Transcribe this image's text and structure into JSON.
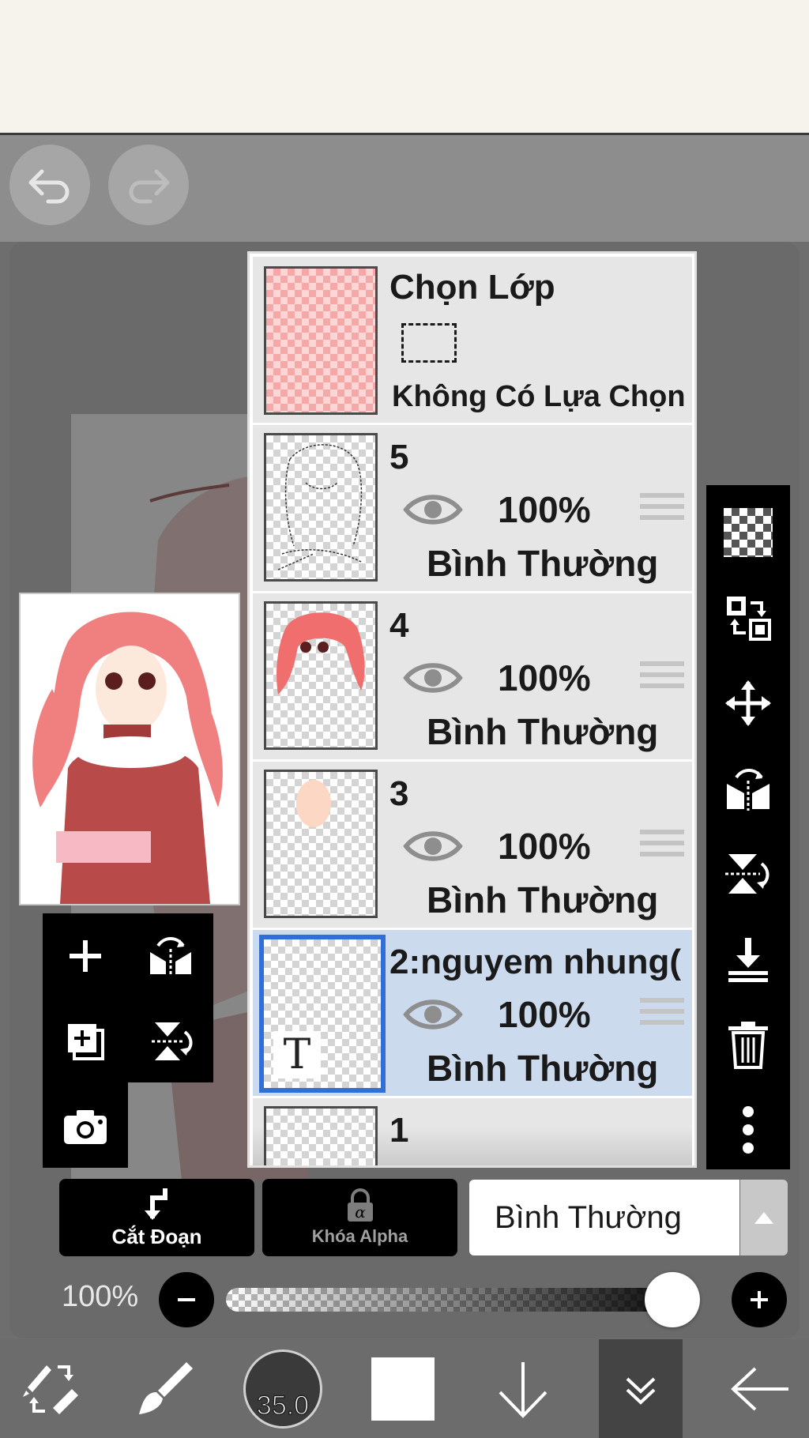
{
  "toolbar": {
    "undo_icon": "undo-icon",
    "redo_icon": "redo-icon"
  },
  "layers_panel": {
    "selection_layer": {
      "title": "Chọn Lớp",
      "subtitle": "Không Có Lựa Chọn"
    },
    "layers": [
      {
        "name": "5",
        "opacity": "100%",
        "blend": "Bình Thường",
        "selected": false,
        "thumbnail": "line-art"
      },
      {
        "name": "4",
        "opacity": "100%",
        "blend": "Bình Thường",
        "selected": false,
        "thumbnail": "pink-hair"
      },
      {
        "name": "3",
        "opacity": "100%",
        "blend": "Bình Thường",
        "selected": false,
        "thumbnail": "skin"
      },
      {
        "name": "2:nguyem nhung(",
        "opacity": "100%",
        "blend": "Bình Thường",
        "selected": true,
        "thumbnail": "text-layer",
        "thumb_glyph": "T"
      },
      {
        "name": "1",
        "opacity": "",
        "blend": "",
        "selected": false,
        "thumbnail": "empty"
      }
    ]
  },
  "left_tools": [
    "add-layer-icon",
    "flip-horizontal-icon",
    "duplicate-layer-icon",
    "flip-vertical-icon",
    "camera-icon"
  ],
  "right_tools": [
    "transparency-icon",
    "replace-icon",
    "move-icon",
    "flip-horizontal-icon",
    "flip-vertical-icon",
    "merge-down-icon",
    "trash-icon",
    "more-icon"
  ],
  "layer_controls": {
    "clip_label": "Cắt Đoạn",
    "alpha_lock_label": "Khóa Alpha",
    "blend_mode": "Bình Thường",
    "opacity_label": "100%",
    "opacity_value": 1.0
  },
  "bottom_bar": {
    "brush_size": "35.0",
    "primary_color": "#ffffff",
    "icons": [
      "swap-tool-icon",
      "brush-icon",
      "brush-size-icon",
      "color-icon",
      "down-arrow-icon",
      "layers-icon",
      "back-arrow-icon"
    ]
  }
}
